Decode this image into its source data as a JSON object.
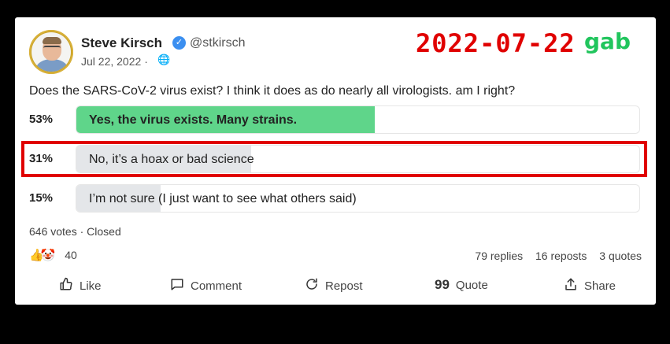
{
  "post": {
    "author_name": "Steve Kirsch",
    "handle": "@stkirsch",
    "date": "Jul 22, 2022",
    "date_separator": "·",
    "question": "Does the SARS-CoV-2 virus exist? I think it does as do nearly all virologists. am I right?"
  },
  "overlay": {
    "date_stamp": "2022-07-22",
    "site_label": "gab",
    "stamp_color": "#e00000",
    "site_color": "#21c55d"
  },
  "poll": {
    "options": [
      {
        "percent": "53%",
        "label": "Yes, the virus exists. Many strains.",
        "share": 0.53,
        "winner": true,
        "fill_color": "#5fd58a"
      },
      {
        "percent": "31%",
        "label": "No, it’s a hoax or bad science",
        "share": 0.31,
        "winner": false,
        "fill_color": "#e4e6e9"
      },
      {
        "percent": "15%",
        "label": "I’m not sure (I just want to see what others said)",
        "share": 0.15,
        "winner": false,
        "fill_color": "#e4e6e9"
      }
    ],
    "votes_text": "646 votes",
    "separator": "·",
    "status": "Closed"
  },
  "engagement": {
    "reaction_count": "40",
    "replies": "79 replies",
    "reposts": "16 reposts",
    "quotes": "3 quotes"
  },
  "actions": {
    "like": "Like",
    "comment": "Comment",
    "repost": "Repost",
    "quote": "Quote",
    "share": "Share"
  },
  "icons": {
    "verified": "verified-badge-icon",
    "globe": "globe-icon",
    "like": "thumbs-up-icon",
    "comment": "comment-icon",
    "repost": "repost-icon",
    "quote": "quote-icon",
    "share": "share-icon"
  }
}
